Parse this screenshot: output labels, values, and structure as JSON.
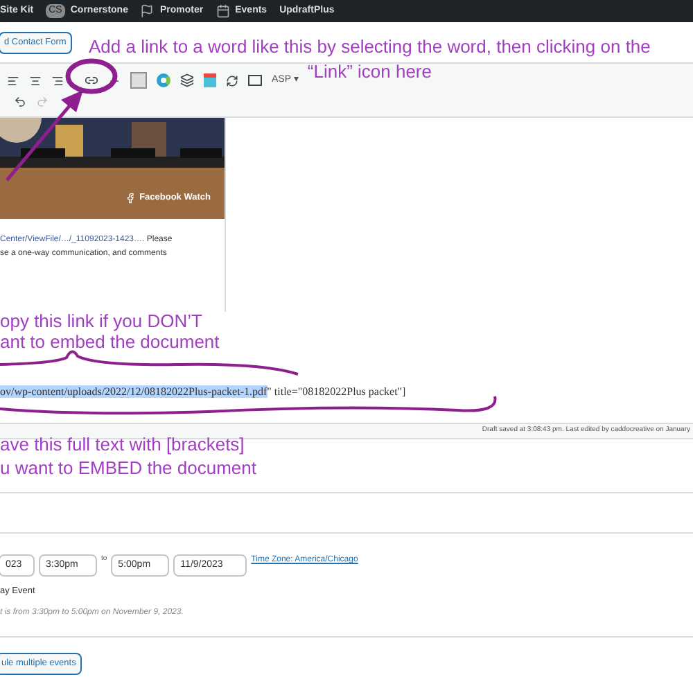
{
  "admin_bar": {
    "items": [
      {
        "label": "Site Kit",
        "kind": "text"
      },
      {
        "label": "Cornerstone",
        "kind": "cs"
      },
      {
        "label": "Promoter",
        "kind": "flag"
      },
      {
        "label": "Events",
        "kind": "calendar"
      },
      {
        "label": "UpdraftPlus",
        "kind": "text"
      }
    ],
    "cs_badge": "CS"
  },
  "editor": {
    "add_form_button": "d Contact Form",
    "asp_menu": "ASP ▾",
    "embed": {
      "badge": "Facebook Watch",
      "link": "Center/ViewFile/…/_11092023-1423….",
      "link_after": " Please",
      "line_2": "se a one-way communication, and comments"
    },
    "code": {
      "selected": "ov/wp-content/uploads/2022/12/08182022Plus-packet-1.pdf",
      "rest": "\" title=\"08182022Plus packet\"]"
    },
    "status": "Draft saved at 3:08:43 pm. Last edited by caddocreative on January"
  },
  "event": {
    "start_date": "023",
    "start_time": "3:30pm",
    "to": "to",
    "end_time": "5:00pm",
    "end_date": "11/9/2023",
    "timezone": "Time Zone: America/Chicago",
    "all_day": "ay Event",
    "summary": "t is from 3:30pm to 5:00pm on November 9, 2023.",
    "multi_button": "ule multiple events"
  },
  "annotations": {
    "link_tip": [
      "Add a link to a word like this by selecting the word, then clicking on the",
      "“Link” icon here"
    ],
    "copy_tip": [
      "opy this link if you DON’T",
      "ant to embed the document"
    ],
    "save_tip": [
      "ave this full text with [brackets]",
      "u want to EMBED the document"
    ]
  }
}
